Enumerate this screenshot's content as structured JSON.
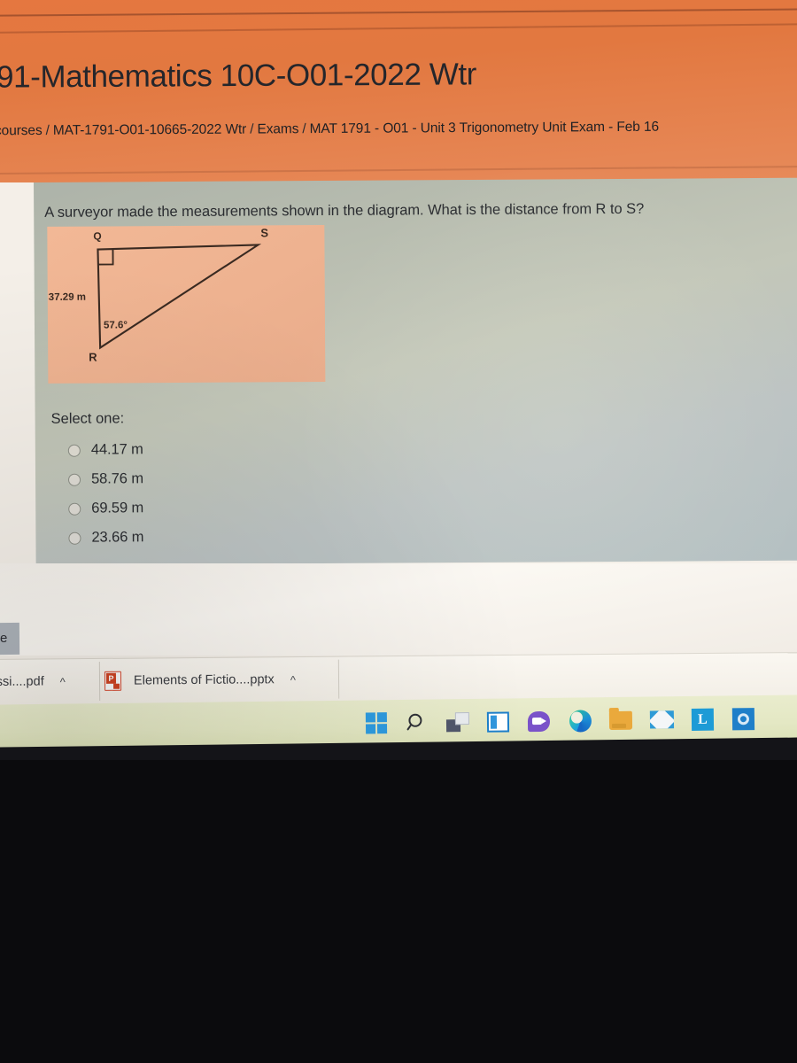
{
  "header": {
    "title": "91-Mathematics 10C-O01-2022 Wtr",
    "breadcrumb": [
      "courses",
      "MAT-1791-O01-10665-2022 Wtr",
      "Exams",
      "MAT 1791 - O01 - Unit 3 Trigonometry Unit Exam - Feb 16"
    ],
    "separator": "/",
    "background_color": "#e2783f"
  },
  "question": {
    "text": "A surveyor made the measurements shown in the diagram. What is the distance from R to S?",
    "select_prompt": "Select one:",
    "options": [
      {
        "label": "44.17 m",
        "selected": false
      },
      {
        "label": "58.76 m",
        "selected": false
      },
      {
        "label": "69.59 m",
        "selected": false
      },
      {
        "label": "23.66 m",
        "selected": false
      }
    ]
  },
  "diagram": {
    "background_color": "#f0b492",
    "line_color": "#3a2a21",
    "vertices": [
      {
        "name": "Q",
        "label": "Q"
      },
      {
        "name": "S",
        "label": "S"
      },
      {
        "name": "R",
        "label": "R"
      }
    ],
    "side_label": "37.29 m",
    "angle_label": "57.6°",
    "right_angle_at": "Q"
  },
  "downloads_bar": {
    "items": [
      {
        "name": "Assi....pdf",
        "icon": "none",
        "chevron": "^"
      },
      {
        "name": "Elements of Fictio....pptx",
        "icon": "powerpoint-icon",
        "chevron": "^"
      }
    ]
  },
  "edge_tab": {
    "label": "e"
  },
  "taskbar": {
    "icons": [
      {
        "name": "start-icon",
        "label": "Start"
      },
      {
        "name": "search-icon",
        "label": "Search"
      },
      {
        "name": "task-view-icon",
        "label": "Task View"
      },
      {
        "name": "widgets-icon",
        "label": "Widgets"
      },
      {
        "name": "teams-chat-icon",
        "label": "Chat"
      },
      {
        "name": "edge-icon",
        "label": "Microsoft Edge"
      },
      {
        "name": "file-explorer-icon",
        "label": "File Explorer"
      },
      {
        "name": "mail-icon",
        "label": "Mail"
      },
      {
        "name": "lockdown-browser-icon",
        "label": "L"
      },
      {
        "name": "outlook-icon",
        "label": "Outlook"
      }
    ],
    "background_color": "#e4e8c4"
  }
}
